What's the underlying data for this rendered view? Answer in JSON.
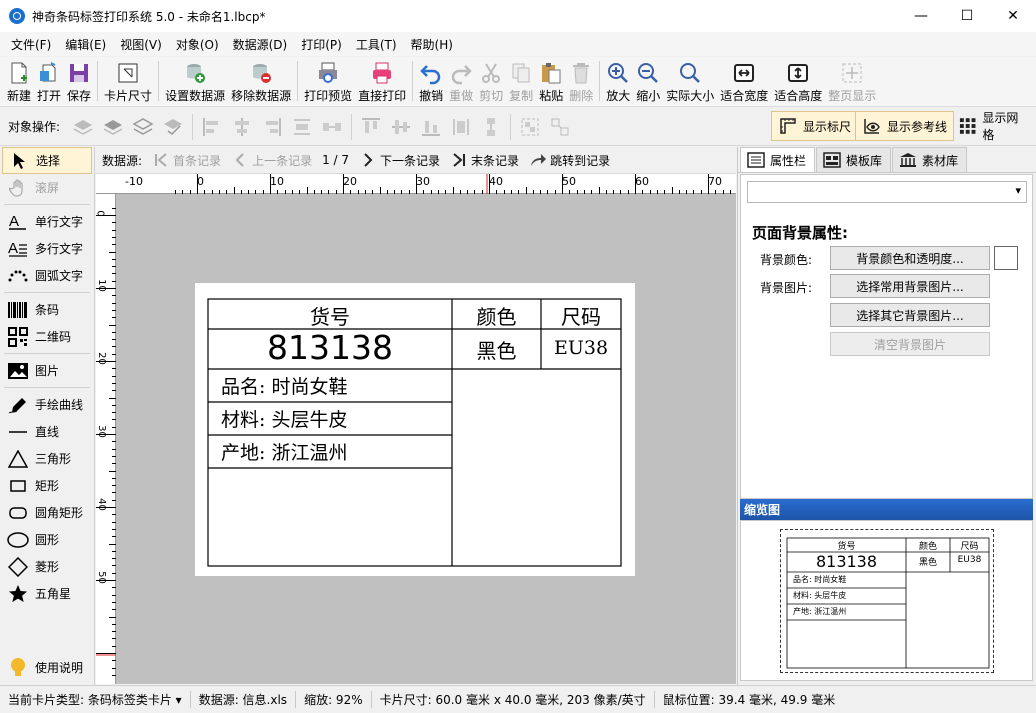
{
  "window": {
    "title": "神奇条码标签打印系统 5.0 - 未命名1.lbcp*",
    "minimize": "—",
    "maximize": "☐",
    "close": "✕"
  },
  "menu": [
    "文件(F)",
    "编辑(E)",
    "视图(V)",
    "对象(O)",
    "数据源(D)",
    "打印(P)",
    "工具(T)",
    "帮助(H)"
  ],
  "toolbar": {
    "new": "新建",
    "open": "打开",
    "save": "保存",
    "card_size": "卡片尺寸",
    "set_ds": "设置数据源",
    "remove_ds": "移除数据源",
    "print_preview": "打印预览",
    "direct_print": "直接打印",
    "undo": "撤销",
    "redo": "重做",
    "cut": "剪切",
    "copy": "复制",
    "paste": "粘贴",
    "delete": "删除",
    "zoom_in": "放大",
    "zoom_out": "缩小",
    "actual_size": "实际大小",
    "fit_width": "适合宽度",
    "fit_height": "适合高度",
    "fit_page": "整页显示"
  },
  "ops": {
    "label": "对象操作:",
    "show_ruler": "显示标尺",
    "show_guides": "显示参考线",
    "show_grid": "显示网格"
  },
  "tools": {
    "select": "选择",
    "scroll": "滚屏",
    "single_text": "单行文字",
    "multi_text": "多行文字",
    "arc_text": "圆弧文字",
    "barcode": "条码",
    "qrcode": "二维码",
    "image": "图片",
    "freehand": "手绘曲线",
    "line": "直线",
    "triangle": "三角形",
    "rectangle": "矩形",
    "round_rect": "圆角矩形",
    "ellipse": "圆形",
    "diamond": "菱形",
    "star": "五角星",
    "help": "使用说明"
  },
  "datasource": {
    "label": "数据源:",
    "first": "首条记录",
    "prev": "上一条记录",
    "position": "1 / 7",
    "next": "下一条记录",
    "last": "末条记录",
    "jump": "跳转到记录"
  },
  "ruler": {
    "top_labels": [
      "-10",
      "0",
      "10",
      "20",
      "30",
      "40",
      "50",
      "60",
      "70"
    ],
    "left_labels": [
      "0",
      "10",
      "20",
      "30",
      "40",
      "50"
    ]
  },
  "label": {
    "item_no_header": "货号",
    "item_no": "813138",
    "color_header": "颜色",
    "color": "黑色",
    "size_header": "尺码",
    "size": "EU38",
    "name": "品名: 时尚女鞋",
    "material": "材料: 头层牛皮",
    "origin": "产地: 浙江温州"
  },
  "rpanel": {
    "tabs": [
      "属性栏",
      "模板库",
      "素材库"
    ],
    "prop_title": "页面背景属性:",
    "bg_color_label": "背景颜色:",
    "bg_color_btn": "背景颜色和透明度...",
    "bg_image_label": "背景图片:",
    "choose_common": "选择常用背景图片...",
    "choose_other": "选择其它背景图片...",
    "clear_bg": "清空背景图片",
    "thumb_title": "缩览图"
  },
  "status": {
    "card_type": "当前卡片类型: 条码标签类卡片 ▾",
    "datasource": "数据源: 信息.xls",
    "zoom": "缩放: 92%",
    "card_size": "卡片尺寸: 60.0 毫米 x 40.0 毫米, 203 像素/英寸",
    "mouse": "鼠标位置: 39.4 毫米, 49.9 毫米"
  }
}
